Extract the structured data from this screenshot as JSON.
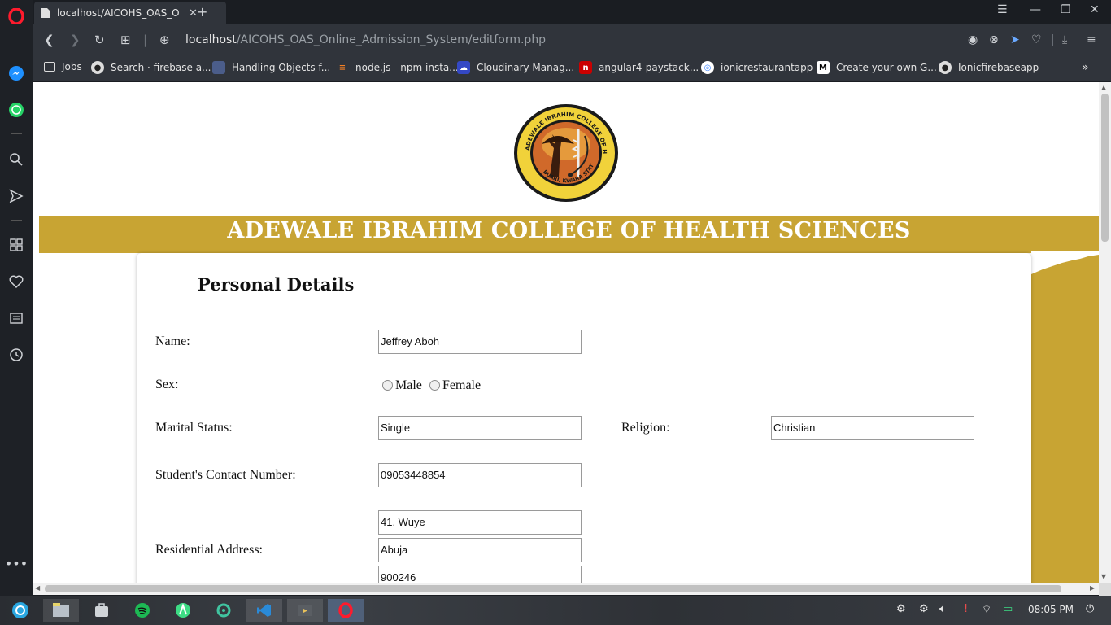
{
  "browser": {
    "tab_title": "localhost/AICOHS_OAS_Or",
    "url_host": "localhost",
    "url_path": "/AICOHS_OAS_Online_Admission_System/editform.php"
  },
  "bookmarks": [
    {
      "label": "Jobs",
      "icon": "folder-icon"
    },
    {
      "label": "Search · firebase a...",
      "icon": "github-icon"
    },
    {
      "label": "Handling Objects f...",
      "icon": "avatar-icon"
    },
    {
      "label": "node.js - npm insta...",
      "icon": "stackoverflow-icon"
    },
    {
      "label": "Cloudinary Manag...",
      "icon": "cloudinary-icon"
    },
    {
      "label": "angular4-paystack...",
      "icon": "npm-icon"
    },
    {
      "label": "ionicrestaurantapp",
      "icon": "ionic-icon"
    },
    {
      "label": "Create your own G...",
      "icon": "medium-icon"
    },
    {
      "label": "Ionicfirebaseapp",
      "icon": "github-icon"
    }
  ],
  "page": {
    "college_name": "ADEWALE IBRAHIM COLLEGE OF HEALTH SCIENCES",
    "logo_text_top": "ADEWALE IBRAHIM COLLEGE OF HEALTH SCIENCES",
    "logo_text_bottom": "BUARI, KWARA STATE.",
    "section_title": "Personal Details",
    "colors": {
      "gold": "#c8a433"
    }
  },
  "form": {
    "name_label": "Name:",
    "name_value": "Jeffrey Aboh",
    "sex_label": "Sex:",
    "sex_options": [
      "Male",
      "Female"
    ],
    "marital_label": "Marital Status:",
    "marital_value": "Single",
    "religion_label": "Religion:",
    "religion_value": "Christian",
    "contact_label": "Student's Contact Number:",
    "contact_value": "09053448854",
    "address_label": "Residential Address:",
    "address_line1": "41, Wuye",
    "address_line2": "Abuja",
    "address_line3": "900246"
  },
  "taskbar": {
    "clock": "08:05 PM"
  }
}
